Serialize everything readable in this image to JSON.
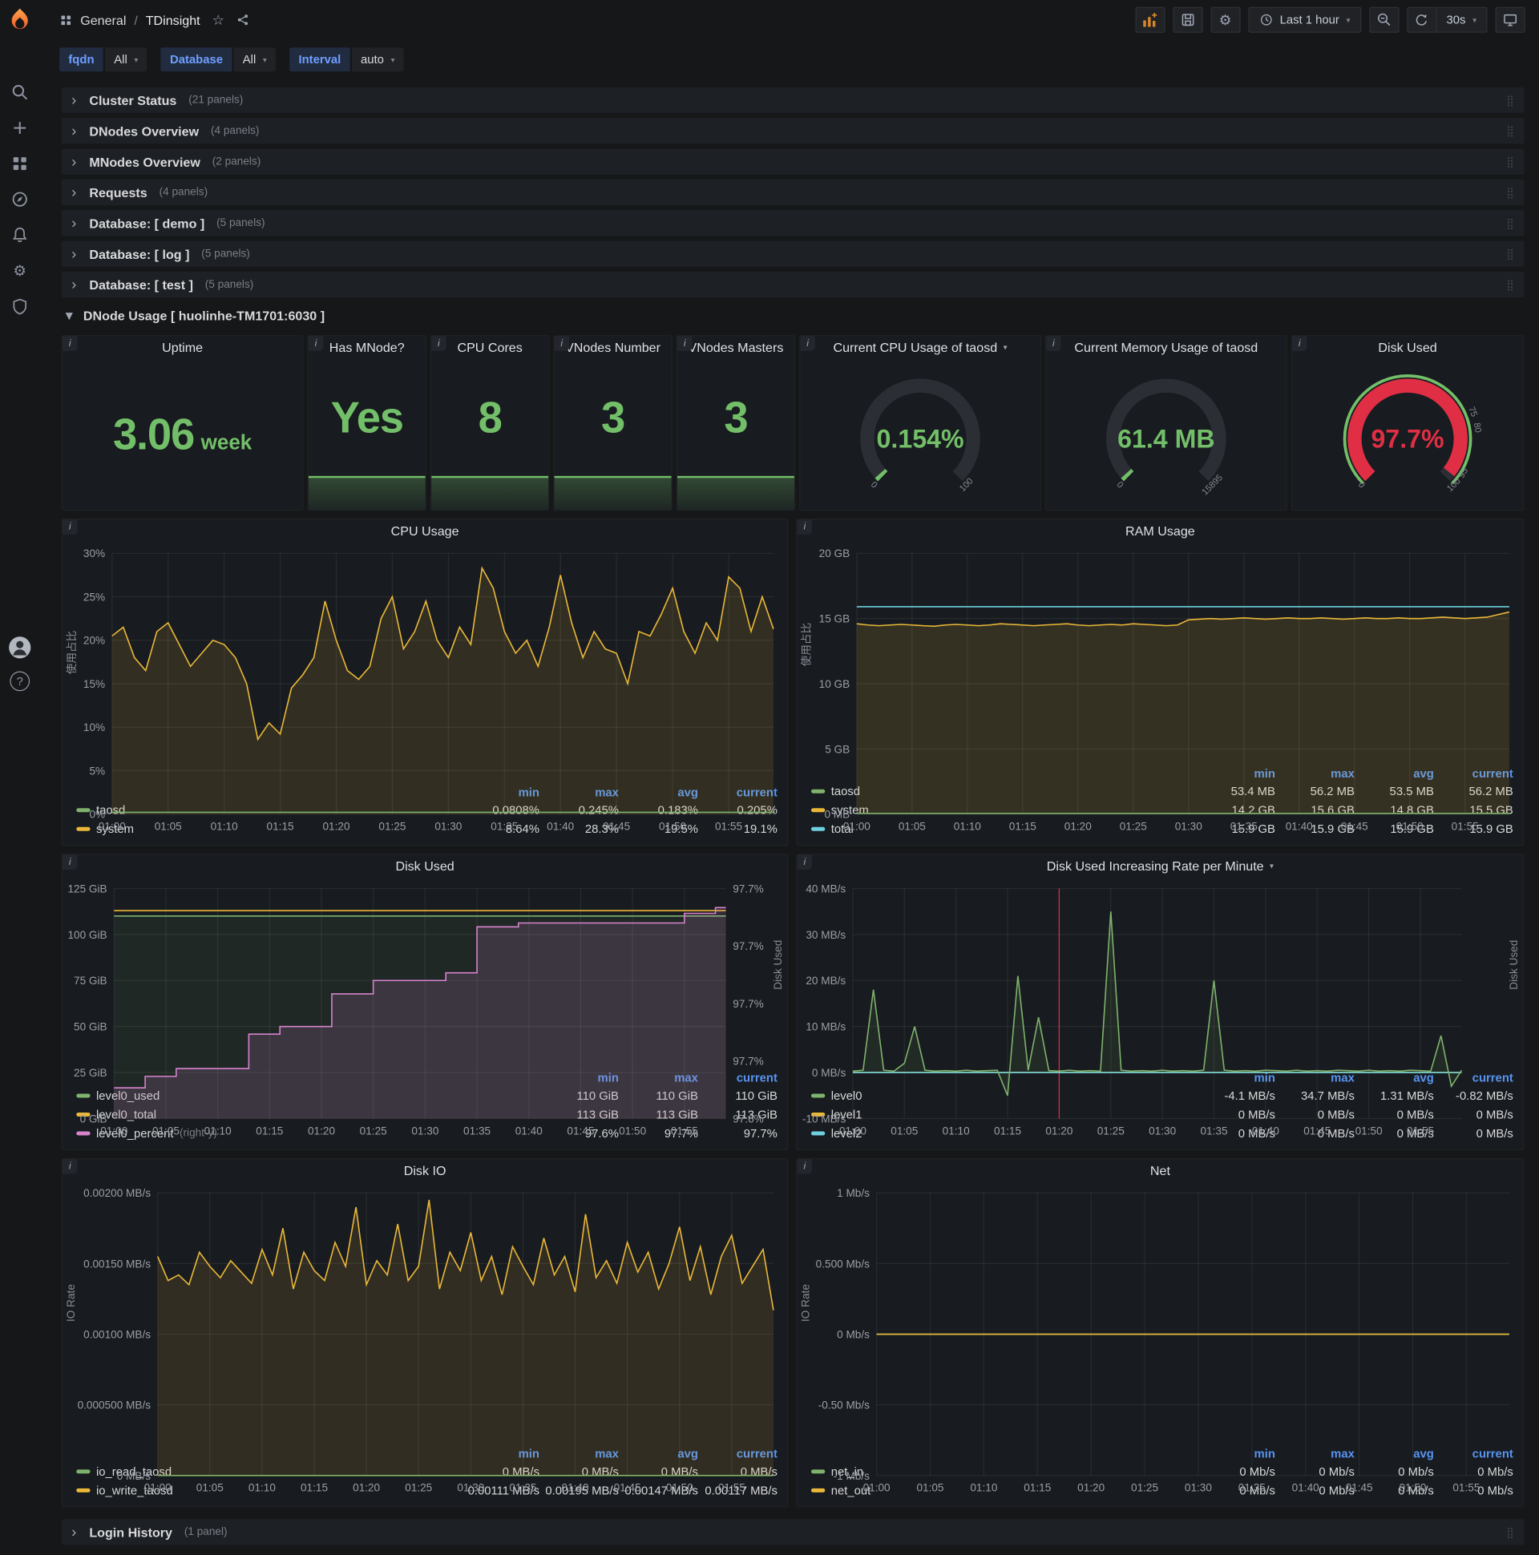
{
  "nav": {
    "section": "General",
    "separator": "/",
    "title": "TDinsight",
    "time_range": "Last 1 hour",
    "refresh_interval": "30s"
  },
  "icons": {
    "gear": "⚙",
    "star": "☆",
    "caret_down": "▾",
    "chevron_right": "›",
    "chevron_down": "▾",
    "drag_handle": "⣿",
    "info": "i",
    "help": "?"
  },
  "variables": [
    {
      "label": "fqdn",
      "value": "All"
    },
    {
      "label": "Database",
      "value": "All"
    },
    {
      "label": "Interval",
      "value": "auto"
    }
  ],
  "collapsed_rows": [
    {
      "title": "Cluster Status",
      "count": "(21 panels)"
    },
    {
      "title": "DNodes Overview",
      "count": "(4 panels)"
    },
    {
      "title": "MNodes Overview",
      "count": "(2 panels)"
    },
    {
      "title": "Requests",
      "count": "(4 panels)"
    },
    {
      "title": "Database: [ demo ]",
      "count": "(5 panels)"
    },
    {
      "title": "Database: [ log ]",
      "count": "(5 panels)"
    },
    {
      "title": "Database: [ test ]",
      "count": "(5 panels)"
    }
  ],
  "expanded_row": {
    "title": "DNode Usage [ huolinhe-TM1701:6030 ]"
  },
  "bottom_rows": [
    {
      "title": "Login History",
      "count": "(1 panel)"
    }
  ],
  "stats": [
    {
      "title": "Uptime",
      "value": "3.06",
      "suffix": "week"
    },
    {
      "title": "Has MNode?",
      "value": "Yes"
    },
    {
      "title": "CPU Cores",
      "value": "8"
    },
    {
      "title": "VNodes Number",
      "value": "3"
    },
    {
      "title": "VNodes Masters",
      "value": "3"
    }
  ],
  "gauges": [
    {
      "id": "gauge-cpu",
      "title": "Current CPU Usage of taosd",
      "value": "0.154%",
      "color": "#73bf69",
      "frac": 0.0154,
      "labels": [
        {
          "t": "0",
          "f": 0
        },
        {
          "t": "100",
          "f": 1
        }
      ]
    },
    {
      "id": "gauge-mem",
      "title": "Current Memory Usage of taosd",
      "value": "61.4 MB",
      "color": "#73bf69",
      "frac": 0.012,
      "labels": [
        {
          "t": "0",
          "f": 0
        },
        {
          "t": "15895",
          "f": 1
        }
      ]
    },
    {
      "id": "gauge-disk",
      "title": "Disk Used",
      "value": "97.7%",
      "color": "#e02f44",
      "frac": 0.977,
      "ring": [
        {
          "from": 0,
          "to": 1,
          "color": "#73bf69"
        }
      ],
      "labels": [
        {
          "t": "0",
          "f": 0
        },
        {
          "t": "75",
          "f": 0.75
        },
        {
          "t": "80",
          "f": 0.8
        },
        {
          "t": "95",
          "f": 0.95
        },
        {
          "t": "100",
          "f": 1
        }
      ]
    }
  ],
  "charts": [
    {
      "id": "cpu",
      "type": "line",
      "title": "CPU Usage",
      "y_label": "使用占比",
      "ymin": 0,
      "ymax": 30,
      "yticks": [
        {
          "v": 0,
          "t": "0%"
        },
        {
          "v": 5,
          "t": "5%"
        },
        {
          "v": 10,
          "t": "10%"
        },
        {
          "v": 15,
          "t": "15%"
        },
        {
          "v": 20,
          "t": "20%"
        },
        {
          "v": 25,
          "t": "25%"
        },
        {
          "v": 30,
          "t": "30%"
        }
      ],
      "xlabels": [
        "01:00",
        "01:05",
        "01:10",
        "01:15",
        "01:20",
        "01:25",
        "01:30",
        "01:35",
        "01:40",
        "01:45",
        "01:50",
        "01:55"
      ],
      "series": [
        {
          "name": "system",
          "color": "#eab839",
          "fill": 0.13,
          "data": [
            20.5,
            21.5,
            18,
            16.5,
            21,
            22,
            19.5,
            17,
            18.5,
            20,
            19.5,
            18,
            15,
            8.6,
            10.5,
            9.2,
            14.5,
            16,
            18,
            24.5,
            20,
            16.5,
            15.5,
            17,
            22.5,
            25,
            19,
            21,
            24.5,
            20,
            18,
            21.5,
            19.5,
            28.3,
            26,
            21,
            18.5,
            20,
            17,
            21.5,
            27.5,
            22,
            18,
            21,
            19,
            18.5,
            15,
            21,
            20.5,
            23,
            26,
            21,
            18.5,
            22,
            20,
            27.3,
            26,
            21,
            25,
            21.3
          ]
        },
        {
          "name": "taosd",
          "color": "#7eb26d",
          "const": 0.2
        }
      ],
      "legend": {
        "headers": [
          "min",
          "max",
          "avg",
          "current"
        ],
        "rows": [
          {
            "name": "taosd",
            "color": "#7eb26d",
            "values": [
              "0.0808%",
              "0.245%",
              "0.183%",
              "0.205%"
            ]
          },
          {
            "name": "system",
            "color": "#eab839",
            "values": [
              "8.64%",
              "28.3%",
              "19.5%",
              "19.1%"
            ]
          }
        ]
      }
    },
    {
      "id": "ram",
      "type": "line",
      "title": "RAM Usage",
      "y_label": "使用占比",
      "ymin": 0,
      "ymax": 20,
      "yticks": [
        {
          "v": 0,
          "t": "0 MB"
        },
        {
          "v": 5,
          "t": "5 GB"
        },
        {
          "v": 10,
          "t": "10 GB"
        },
        {
          "v": 15,
          "t": "15 GB"
        },
        {
          "v": 20,
          "t": "20 GB"
        }
      ],
      "xlabels": [
        "01:00",
        "01:05",
        "01:10",
        "01:15",
        "01:20",
        "01:25",
        "01:30",
        "01:35",
        "01:40",
        "01:45",
        "01:50",
        "01:55"
      ],
      "series": [
        {
          "name": "system",
          "color": "#eab839",
          "fill": 0.14,
          "data": [
            14.6,
            14.5,
            14.45,
            14.5,
            14.55,
            14.5,
            14.45,
            14.4,
            14.5,
            14.55,
            14.5,
            14.45,
            14.5,
            14.6,
            14.55,
            14.5,
            14.45,
            14.5,
            14.55,
            14.6,
            14.5,
            14.45,
            14.5,
            14.55,
            14.5,
            14.6,
            14.55,
            14.5,
            14.45,
            14.5,
            14.9,
            14.95,
            15.0,
            14.95,
            15.0,
            15.05,
            15.0,
            14.95,
            15.0,
            15.05,
            15.0,
            15.0,
            15.05,
            15.0,
            14.95,
            15.0,
            15.05,
            15.0,
            15.0,
            15.05,
            15.0,
            15.0,
            15.05,
            15.1,
            15.05,
            15.0,
            15.05,
            15.1,
            15.3,
            15.5
          ]
        },
        {
          "name": "total",
          "color": "#6ed0e0",
          "const": 15.9
        },
        {
          "name": "taosd",
          "color": "#7eb26d",
          "const": 0.055
        }
      ],
      "legend": {
        "headers": [
          "min",
          "max",
          "avg",
          "current"
        ],
        "rows": [
          {
            "name": "taosd",
            "color": "#7eb26d",
            "values": [
              "53.4 MB",
              "56.2 MB",
              "53.5 MB",
              "56.2 MB"
            ]
          },
          {
            "name": "system",
            "color": "#eab839",
            "values": [
              "14.2 GB",
              "15.6 GB",
              "14.8 GB",
              "15.5 GB"
            ]
          },
          {
            "name": "total",
            "color": "#6ed0e0",
            "values": [
              "15.9 GB",
              "15.9 GB",
              "15.9 GB",
              "15.9 GB"
            ]
          }
        ]
      }
    },
    {
      "id": "disk",
      "type": "line",
      "title": "Disk Used",
      "y2_label": "Disk Used",
      "ymin": 0,
      "ymax": 125,
      "y2min": 97.59,
      "y2max": 97.71,
      "yticks": [
        {
          "v": 0,
          "t": "0 GiB"
        },
        {
          "v": 25,
          "t": "25 GiB"
        },
        {
          "v": 50,
          "t": "50 GiB"
        },
        {
          "v": 75,
          "t": "75 GiB"
        },
        {
          "v": 100,
          "t": "100 GiB"
        },
        {
          "v": 125,
          "t": "125 GiB"
        }
      ],
      "y2ticks": [
        "97.7%",
        "97.7%",
        "97.7%",
        "97.7%",
        "97.6%"
      ],
      "xlabels": [
        "01:00",
        "01:05",
        "01:10",
        "01:15",
        "01:20",
        "01:25",
        "01:30",
        "01:35",
        "01:40",
        "01:45",
        "01:50",
        "01:55"
      ],
      "series": [
        {
          "name": "level0_used",
          "color": "#7eb26d",
          "fill": 0.09,
          "const": 110
        },
        {
          "name": "level0_total",
          "color": "#eab839",
          "const": 113
        },
        {
          "name": "level0_percent",
          "color": "#d683ce",
          "axis": "right",
          "step": true,
          "fill": 0.16,
          "data": [
            97.606,
            97.606,
            97.606,
            97.612,
            97.612,
            97.612,
            97.616,
            97.616,
            97.616,
            97.616,
            97.616,
            97.616,
            97.616,
            97.634,
            97.634,
            97.634,
            97.638,
            97.638,
            97.638,
            97.638,
            97.638,
            97.655,
            97.655,
            97.655,
            97.655,
            97.662,
            97.662,
            97.662,
            97.662,
            97.662,
            97.662,
            97.662,
            97.666,
            97.666,
            97.666,
            97.69,
            97.69,
            97.69,
            97.69,
            97.692,
            97.692,
            97.692,
            97.692,
            97.692,
            97.692,
            97.692,
            97.692,
            97.692,
            97.692,
            97.692,
            97.692,
            97.692,
            97.692,
            97.692,
            97.692,
            97.697,
            97.697,
            97.697,
            97.7,
            97.7
          ]
        }
      ],
      "legend": {
        "headers": [
          "min",
          "max",
          "current"
        ],
        "rows": [
          {
            "name": "level0_used",
            "color": "#7eb26d",
            "values": [
              "110 GiB",
              "110 GiB",
              "110 GiB"
            ]
          },
          {
            "name": "level0_total",
            "color": "#eab839",
            "values": [
              "113 GiB",
              "113 GiB",
              "113 GiB"
            ]
          },
          {
            "name": "level0_percent",
            "color": "#d683ce",
            "note": "(right-y)",
            "values": [
              "97.6%",
              "97.7%",
              "97.7%"
            ]
          }
        ]
      }
    },
    {
      "id": "rate",
      "type": "line",
      "title": "Disk Used Increasing Rate per Minute",
      "has_menu": true,
      "y2_label": "Disk Used",
      "ymin": -10,
      "ymax": 40,
      "annotation": 20,
      "yticks": [
        {
          "v": -10,
          "t": "-10 MB/s"
        },
        {
          "v": 0,
          "t": "0 MB/s"
        },
        {
          "v": 10,
          "t": "10 MB/s"
        },
        {
          "v": 20,
          "t": "20 MB/s"
        },
        {
          "v": 30,
          "t": "30 MB/s"
        },
        {
          "v": 40,
          "t": "40 MB/s"
        }
      ],
      "xlabels": [
        "01:00",
        "01:05",
        "01:10",
        "01:15",
        "01:20",
        "01:25",
        "01:30",
        "01:35",
        "01:40",
        "01:45",
        "01:50",
        "01:55"
      ],
      "series": [
        {
          "name": "level1",
          "color": "#eab839",
          "const": 0
        },
        {
          "name": "level2",
          "color": "#6ed0e0",
          "const": 0
        },
        {
          "name": "level0",
          "color": "#7eb26d",
          "fill": 0.1,
          "fillTo": "zero",
          "data": [
            0.3,
            0.5,
            18,
            0.5,
            0.3,
            2,
            10,
            0.5,
            0.3,
            0.4,
            0.3,
            0.5,
            0.3,
            0.4,
            0.5,
            -5,
            21,
            0.5,
            12,
            0.4,
            0.3,
            0.5,
            0.3,
            0.4,
            0.3,
            35,
            0.5,
            0.3,
            0.4,
            0.3,
            0.5,
            0.3,
            0.4,
            0.3,
            0.5,
            20,
            0.5,
            0.3,
            0.4,
            0.3,
            0.5,
            0.4,
            0.3,
            0.5,
            0.3,
            0.4,
            0.3,
            0.5,
            0.4,
            0.3,
            0.5,
            0.3,
            0.4,
            0.3,
            0.5,
            0.4,
            0.3,
            8,
            -3,
            0.5
          ]
        }
      ],
      "legend": {
        "headers": [
          "min",
          "max",
          "avg",
          "current"
        ],
        "rows": [
          {
            "name": "level0",
            "color": "#7eb26d",
            "values": [
              "-4.1 MB/s",
              "34.7 MB/s",
              "1.31 MB/s",
              "-0.82 MB/s"
            ]
          },
          {
            "name": "level1",
            "color": "#eab839",
            "values": [
              "0 MB/s",
              "0 MB/s",
              "0 MB/s",
              "0 MB/s"
            ]
          },
          {
            "name": "level2",
            "color": "#6ed0e0",
            "values": [
              "0 MB/s",
              "0 MB/s",
              "0 MB/s",
              "0 MB/s"
            ]
          }
        ]
      }
    },
    {
      "id": "io",
      "type": "line",
      "title": "Disk IO",
      "y_label": "IO Rate",
      "ymin": 0,
      "ymax": 0.002,
      "yticks": [
        {
          "v": 0,
          "t": "0 MB/s"
        },
        {
          "v": 0.0005,
          "t": "0.000500 MB/s"
        },
        {
          "v": 0.001,
          "t": "0.00100 MB/s"
        },
        {
          "v": 0.0015,
          "t": "0.00150 MB/s"
        },
        {
          "v": 0.002,
          "t": "0.00200 MB/s"
        }
      ],
      "xlabels": [
        "01:00",
        "01:05",
        "01:10",
        "01:15",
        "01:20",
        "01:25",
        "01:30",
        "01:35",
        "01:40",
        "01:45",
        "01:50",
        "01:55"
      ],
      "series": [
        {
          "name": "io_read_taosd",
          "color": "#7eb26d",
          "const": 0
        },
        {
          "name": "io_write_taosd",
          "color": "#eab839",
          "fill": 0.12,
          "data": [
            0.00155,
            0.00138,
            0.00142,
            0.00135,
            0.00158,
            0.00148,
            0.0014,
            0.00152,
            0.00144,
            0.00136,
            0.0016,
            0.00142,
            0.00175,
            0.00132,
            0.00158,
            0.00145,
            0.00138,
            0.00165,
            0.00148,
            0.0019,
            0.00135,
            0.00152,
            0.00142,
            0.00178,
            0.00138,
            0.00148,
            0.00195,
            0.00132,
            0.00158,
            0.00145,
            0.00172,
            0.00138,
            0.00155,
            0.00128,
            0.00162,
            0.00148,
            0.00135,
            0.00168,
            0.00142,
            0.00155,
            0.0013,
            0.00185,
            0.0014,
            0.00152,
            0.00136,
            0.00165,
            0.00144,
            0.00158,
            0.00132,
            0.0015,
            0.00176,
            0.00138,
            0.00162,
            0.00128,
            0.00155,
            0.0017,
            0.00136,
            0.00148,
            0.0016,
            0.00117
          ]
        }
      ],
      "legend": {
        "headers": [
          "min",
          "max",
          "avg",
          "current"
        ],
        "rows": [
          {
            "name": "io_read_taosd",
            "color": "#7eb26d",
            "values": [
              "0 MB/s",
              "0 MB/s",
              "0 MB/s",
              "0 MB/s"
            ]
          },
          {
            "name": "io_write_taosd",
            "color": "#eab839",
            "values": [
              "0.00111 MB/s",
              "0.00195 MB/s",
              "0.00147 MB/s",
              "0.00117 MB/s"
            ]
          }
        ]
      }
    },
    {
      "id": "net",
      "type": "line",
      "title": "Net",
      "y_label": "IO Rate",
      "ymin": -1,
      "ymax": 1,
      "yticks": [
        {
          "v": -1,
          "t": "-1 Mb/s"
        },
        {
          "v": -0.5,
          "t": "-0.50 Mb/s"
        },
        {
          "v": 0,
          "t": "0 Mb/s"
        },
        {
          "v": 0.5,
          "t": "0.500 Mb/s"
        },
        {
          "v": 1,
          "t": "1 Mb/s"
        }
      ],
      "xlabels": [
        "01:00",
        "01:05",
        "01:10",
        "01:15",
        "01:20",
        "01:25",
        "01:30",
        "01:35",
        "01:40",
        "01:45",
        "01:50",
        "01:55"
      ],
      "series": [
        {
          "name": "net_in",
          "color": "#7eb26d",
          "const": 0
        },
        {
          "name": "net_out",
          "color": "#eab839",
          "const": 0
        }
      ],
      "legend": {
        "headers": [
          "min",
          "max",
          "avg",
          "current"
        ],
        "rows": [
          {
            "name": "net_in",
            "color": "#7eb26d",
            "values": [
              "0 Mb/s",
              "0 Mb/s",
              "0 Mb/s",
              "0 Mb/s"
            ]
          },
          {
            "name": "net_out",
            "color": "#eab839",
            "values": [
              "0 Mb/s",
              "0 Mb/s",
              "0 Mb/s",
              "0 Mb/s"
            ]
          }
        ]
      }
    }
  ],
  "colors": {
    "green": "#73bf69",
    "red": "#e02f44",
    "yellow": "#eab839",
    "cyan": "#6ed0e0",
    "pink": "#d683ce",
    "series_green": "#7eb26d",
    "legend_header": "#5794f2"
  }
}
